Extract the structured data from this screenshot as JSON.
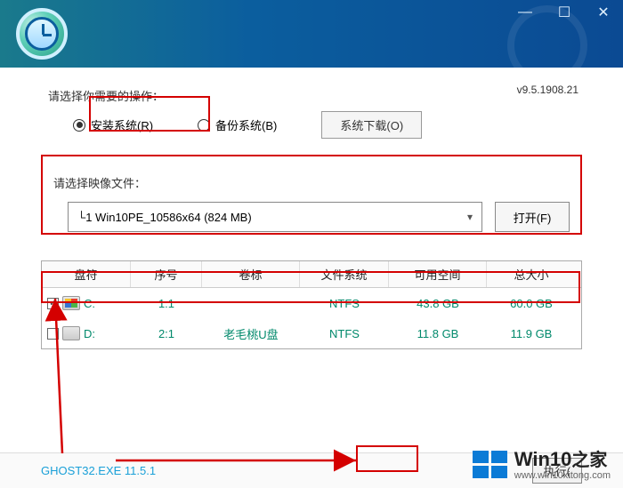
{
  "window": {
    "version": "v9.5.1908.21",
    "min_icon": "minimize-icon",
    "max_icon": "maximize-icon",
    "close_icon": "close-icon"
  },
  "ops": {
    "prompt": "请选择你需要的操作：",
    "install": "安装系统(R)",
    "backup": "备份系统(B)",
    "download": "系统下载(O)",
    "selected": "install"
  },
  "image": {
    "prompt": "请选择映像文件：",
    "selected": "└1 Win10PE_10586x64 (824 MB)",
    "open": "打开(F)"
  },
  "table": {
    "headers": [
      "盘符",
      "序号",
      "卷标",
      "文件系统",
      "可用空间",
      "总大小"
    ],
    "rows": [
      {
        "checked": true,
        "drive": "C:",
        "index": "1:1",
        "label": "",
        "fs": "NTFS",
        "free": "43.8 GB",
        "total": "60.0 GB",
        "icon": "win"
      },
      {
        "checked": false,
        "drive": "D:",
        "index": "2:1",
        "label": "老毛桃U盘",
        "fs": "NTFS",
        "free": "11.8 GB",
        "total": "11.9 GB",
        "icon": "hdd"
      }
    ]
  },
  "footer": {
    "ghost": "GHOST32.EXE 11.5.1",
    "execute": "执行("
  },
  "watermark": {
    "brand_en": "Win10",
    "brand_zh": "之家",
    "url": "www.win10xitong.com"
  }
}
